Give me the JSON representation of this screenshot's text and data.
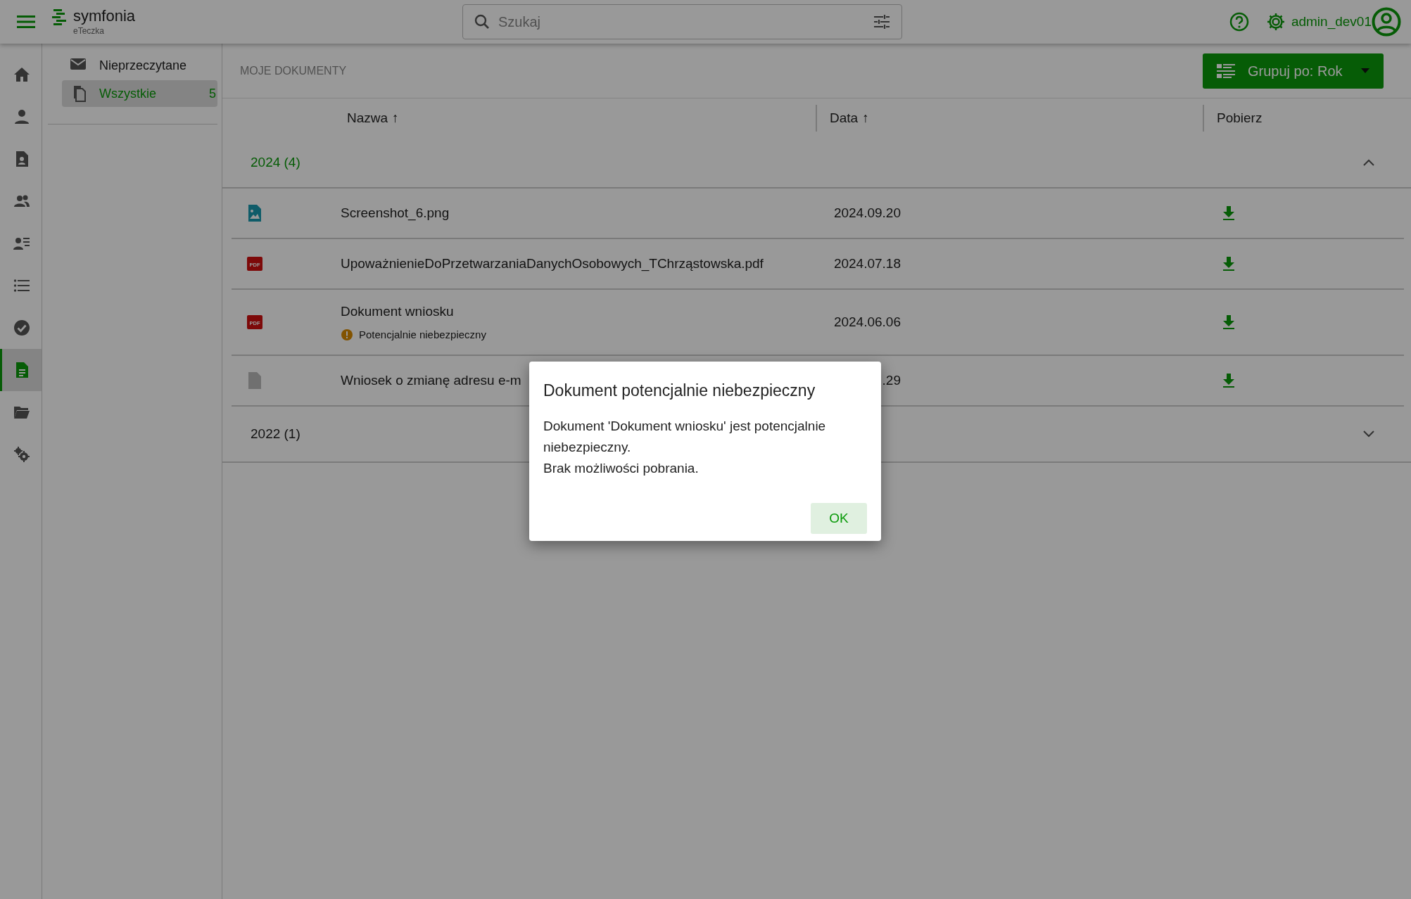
{
  "header": {
    "app_name": "symfonia",
    "app_subtitle": "eTeczka",
    "search": {
      "placeholder": "Szukaj"
    },
    "user": "admin_dev01"
  },
  "rail": [
    {
      "kind": "home",
      "selected": false
    },
    {
      "kind": "person",
      "selected": false
    },
    {
      "kind": "contact-doc",
      "selected": false
    },
    {
      "kind": "people",
      "selected": false
    },
    {
      "kind": "person-list",
      "selected": false
    },
    {
      "kind": "list",
      "selected": false
    },
    {
      "kind": "check",
      "selected": false
    },
    {
      "kind": "document",
      "selected": true
    },
    {
      "kind": "folder",
      "selected": false
    },
    {
      "kind": "gears",
      "selected": false
    }
  ],
  "sidebar": {
    "items": [
      {
        "kind": "mail",
        "label": "Nieprzeczytane",
        "selected": false
      },
      {
        "kind": "copy",
        "label": "Wszystkie",
        "count": "5",
        "selected": true
      }
    ]
  },
  "section_title": "MOJE DOKUMENTY",
  "group_button": "Grupuj po: Rok",
  "table": {
    "columns": [
      {
        "label": "Nazwa",
        "sort_indicator": "↑"
      },
      {
        "label": "Data",
        "sort_indicator": "↑"
      },
      {
        "label": "Pobierz"
      }
    ],
    "groups": [
      {
        "label": "2024 (4)",
        "expanded": true,
        "rows": [
          {
            "kind": "image",
            "name": "Screenshot_6.png",
            "date": "2024.09.20"
          },
          {
            "kind": "pdf",
            "badge": "PDF",
            "name": "UpoważnienieDoPrzetwarzaniaDanychOsobowych_TChrząstowska.pdf",
            "date": "2024.07.18"
          },
          {
            "kind": "pdf",
            "badge": "PDF",
            "name": "Dokument wniosku",
            "warning": "Potencjalnie niebezpieczny",
            "date": "2024.06.06"
          },
          {
            "kind": "file",
            "name": "Wniosek o zmianę adresu e-m",
            "date": ".29"
          }
        ]
      },
      {
        "label": "2022 (1)",
        "expanded": false
      }
    ]
  },
  "dialog": {
    "title": "Dokument potencjalnie niebezpieczny",
    "lines": [
      "Dokument 'Dokument wniosku' jest potencjalnie niebezpieczny.",
      "Brak możliwości pobrania."
    ],
    "button": "OK"
  }
}
